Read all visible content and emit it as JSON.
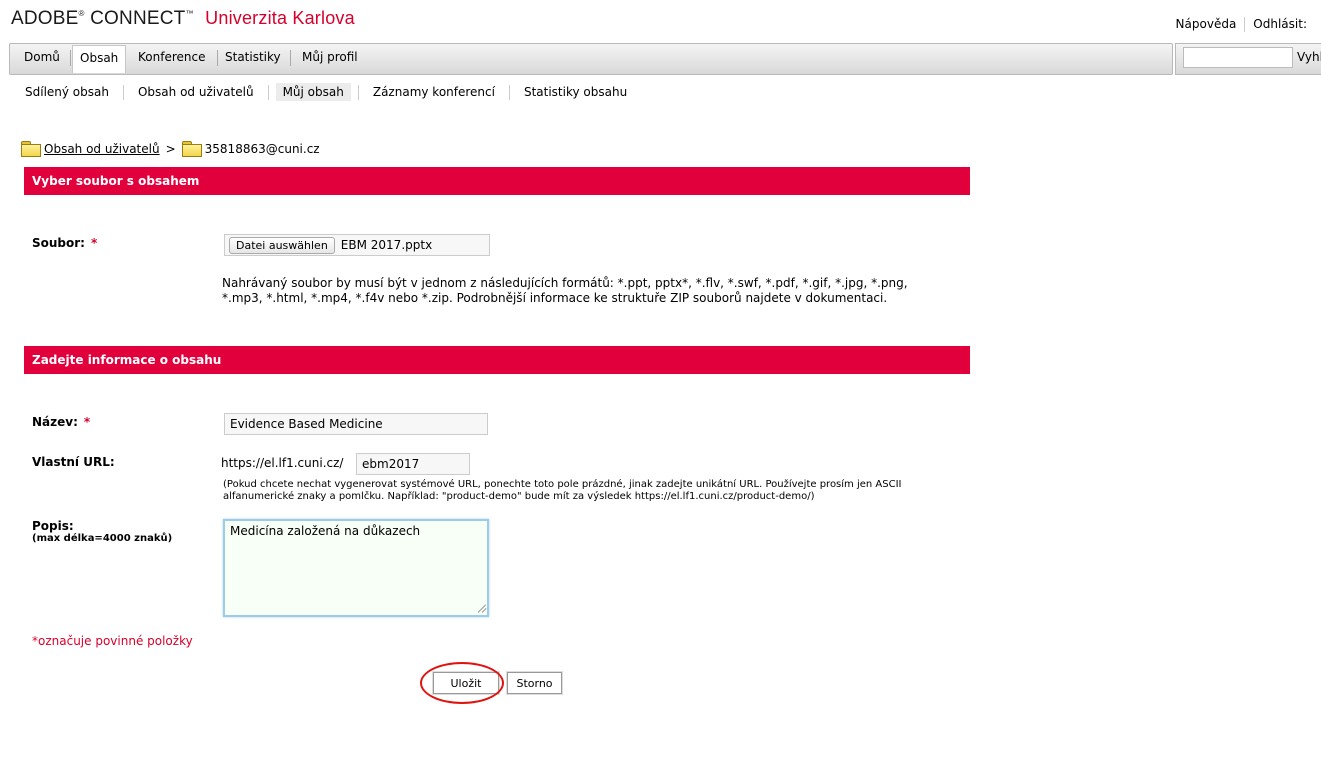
{
  "header": {
    "brand": "ADOBE",
    "brand_reg": "®",
    "brand2": "CONNECT",
    "brand_tm": "™",
    "org": "Univerzita Karlova",
    "help_link": "Nápověda",
    "logout_link": "Odhlásit:"
  },
  "nav": {
    "tabs": [
      "Domů",
      "Obsah",
      "Konference",
      "Statistiky",
      "Můj profil"
    ],
    "active": "Obsah"
  },
  "search": {
    "value": "",
    "label": "Vyhl"
  },
  "subnav": {
    "items": [
      "Sdílený obsah",
      "Obsah od uživatelů",
      "Můj obsah",
      "Záznamy konferencí",
      "Statistiky obsahu"
    ],
    "active": "Můj obsah"
  },
  "breadcrumb": {
    "parent": "Obsah od uživatelů",
    "separator": ">",
    "current": "35818863@cuni.cz"
  },
  "section1": {
    "title": "Vyber soubor s obsahem",
    "file_label": "Soubor:",
    "required_mark": "*",
    "file_button": "Datei auswählen",
    "file_name": "EBM 2017.pptx",
    "help_line1": "Nahrávaný soubor by musí být v jednom z následujících formátů: *.ppt, pptx*, *.flv, *.swf, *.pdf, *.gif, *.jpg, *.png,",
    "help_line2": "*.mp3, *.html, *.mp4, *.f4v nebo *.zip. Podrobnější informace ke struktuře ZIP souborů najdete v dokumentaci."
  },
  "section2": {
    "title": "Zadejte informace o obsahu",
    "name_label": "Název:",
    "required_mark": "*",
    "name_value": "Evidence Based Medicine",
    "url_label": "Vlastní URL:",
    "url_prefix": "https://el.lf1.cuni.cz/",
    "url_value": "ebm2017",
    "url_help_line1": "(Pokud chcete nechat vygenerovat systémové URL, ponechte toto pole prázdné, jinak zadejte unikátní URL. Používejte prosím jen ASCII",
    "url_help_line2": "alfanumerické znaky a pomlčku. Například: \"product-demo\" bude mít za výsledek https://el.lf1.cuni.cz/product-demo/)",
    "desc_label": "Popis:",
    "desc_sublabel": "(max délka=4000 znaků)",
    "desc_value": "Medicína založená na důkazech"
  },
  "required_note": "*označuje povinné položky",
  "buttons": {
    "save": "Uložit",
    "cancel": "Storno"
  },
  "colors": {
    "accent": "#e1003b",
    "brand_red": "#d6002a",
    "highlight": "#e0140f"
  }
}
